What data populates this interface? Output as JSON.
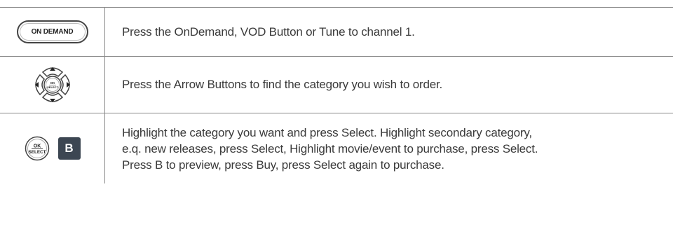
{
  "rows": [
    {
      "icon": "on-demand-button-icon",
      "button_label": "ON DEMAND",
      "text": "Press the OnDemand, VOD Button or Tune to channel 1."
    },
    {
      "icon": "arrow-pad-icon",
      "button_label_top": "OK",
      "button_label_bottom": "SELECT",
      "text": "Press the Arrow Buttons to find the category you wish to order."
    },
    {
      "icon": "ok-select-and-b-button-icons",
      "button_label_top": "OK",
      "button_label_bottom": "SELECT",
      "b_label": "B",
      "text_lines": [
        "Highlight the category you want and press Select. Highlight secondary category,",
        "e.q. new releases, press Select, Highlight movie/event to purchase, press Select.",
        "Press B to preview, press Buy, press Select again to purchase."
      ]
    }
  ],
  "colors": {
    "border": "#888888",
    "text": "#3a3a3a",
    "b_button": "#3c4652"
  }
}
